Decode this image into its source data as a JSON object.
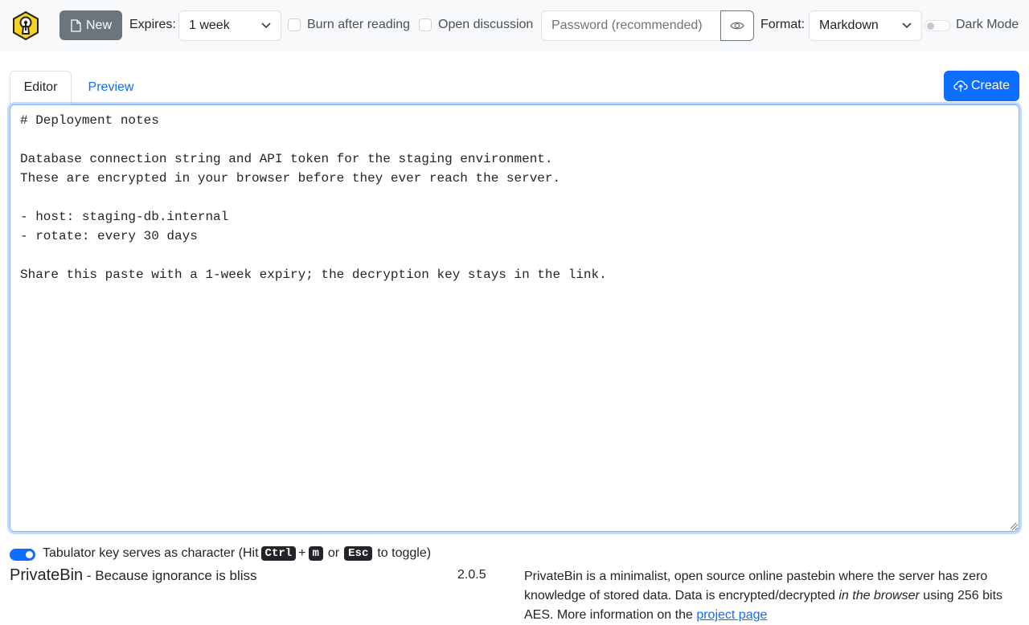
{
  "navbar": {
    "new_label": "New",
    "expires_label": "Expires:",
    "expires_value": "1 week",
    "burn_label": "Burn after reading",
    "discussion_label": "Open discussion",
    "password_placeholder": "Password (recommended)",
    "format_label": "Format:",
    "format_value": "Markdown",
    "dark_mode_label": "Dark Mode"
  },
  "tabs": {
    "editor_label": "Editor",
    "preview_label": "Preview",
    "create_label": "Create"
  },
  "editor": {
    "content": "# Deployment notes\n\nDatabase connection string and API token for the staging environment.\nThese are encrypted in your browser before they ever reach the server.\n\n- host: staging-db.internal\n- rotate: every 30 days\n\nShare this paste with a 1-week expiry; the decryption key stays in the link."
  },
  "footer": {
    "tab_hint_prefix": "Tabulator key serves as character (Hit",
    "kbd_ctrl": "Ctrl",
    "plus": "+",
    "kbd_m": "m",
    "or": "or",
    "kbd_esc": "Esc",
    "tab_hint_suffix": "to toggle)",
    "brand_name": "PrivateBin",
    "brand_tagline": " - Because ignorance is bliss",
    "version": "2.0.5",
    "about_part1": "PrivateBin is a minimalist, open source online pastebin where the server has zero knowledge of stored data. Data is encrypted/decrypted ",
    "about_em": "in the browser",
    "about_part2": " using 256 bits AES. More information on the ",
    "about_link": "project page"
  },
  "colors": {
    "primary": "#0d6efd",
    "secondary": "#6c757d",
    "navbar_bg": "#f8f9fa",
    "logo_yellow": "#f5d21b"
  },
  "icons": {
    "logo": "privatebin-keyhole-logo",
    "new": "file-icon",
    "password_toggle": "eye-icon",
    "create": "cloud-upload-icon"
  }
}
